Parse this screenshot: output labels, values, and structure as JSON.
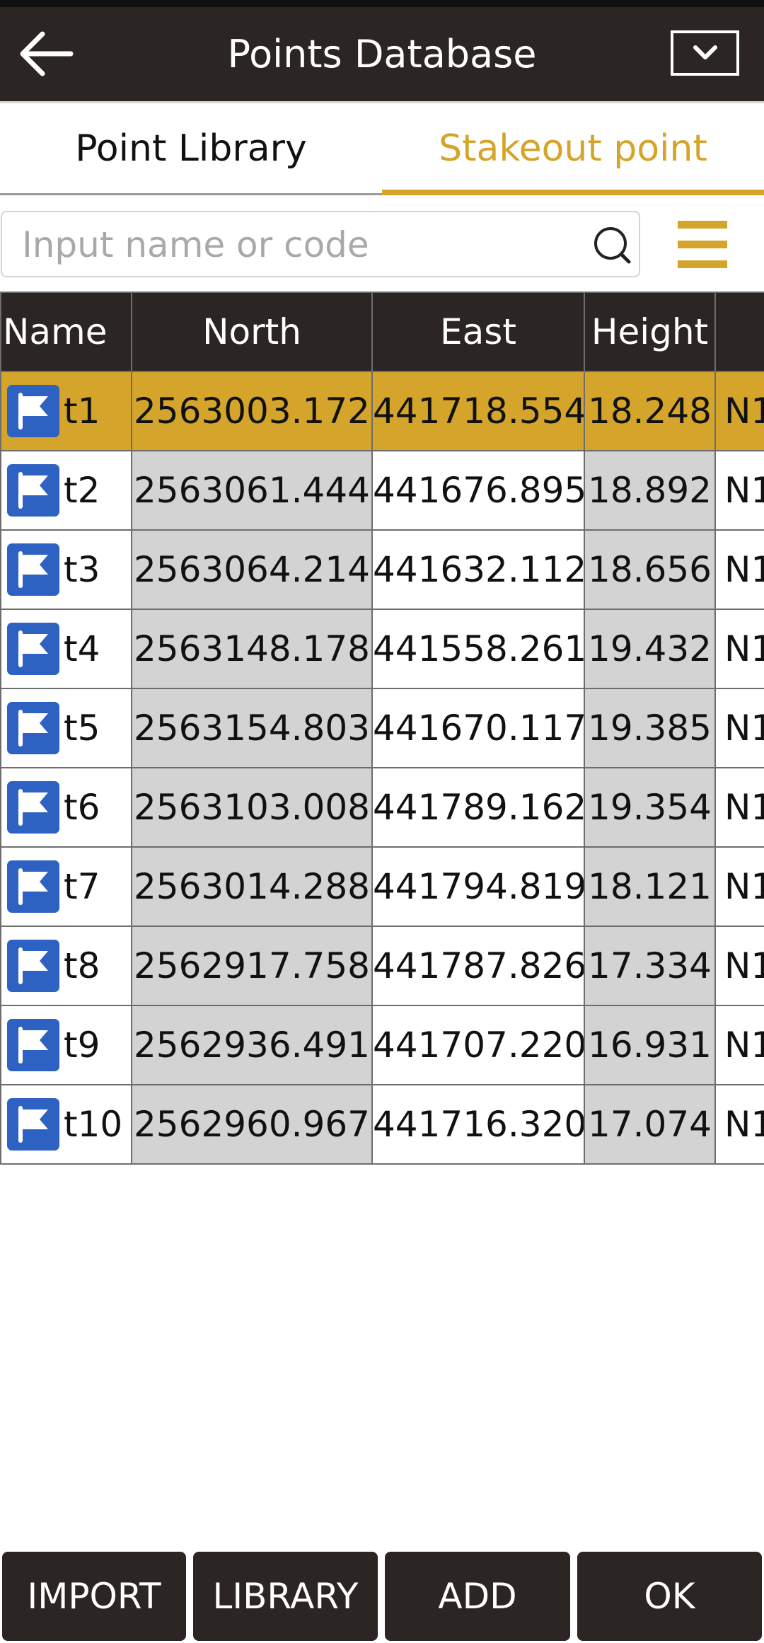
{
  "header": {
    "title": "Points Database"
  },
  "tabs": {
    "library": "Point Library",
    "stakeout": "Stakeout point"
  },
  "search": {
    "placeholder": "Input name or code",
    "value": ""
  },
  "table": {
    "columns": {
      "name": "Name",
      "north": "North",
      "east": "East",
      "height": "Height",
      "code": ""
    },
    "rows": [
      {
        "name": "t1",
        "north": "2563003.172",
        "east": "441718.554",
        "height": "18.248",
        "code": "N1"
      },
      {
        "name": "t2",
        "north": "2563061.444",
        "east": "441676.895",
        "height": "18.892",
        "code": "N1"
      },
      {
        "name": "t3",
        "north": "2563064.214",
        "east": "441632.112",
        "height": "18.656",
        "code": "N1"
      },
      {
        "name": "t4",
        "north": "2563148.178",
        "east": "441558.261",
        "height": "19.432",
        "code": "N1"
      },
      {
        "name": "t5",
        "north": "2563154.803",
        "east": "441670.117",
        "height": "19.385",
        "code": "N1"
      },
      {
        "name": "t6",
        "north": "2563103.008",
        "east": "441789.162",
        "height": "19.354",
        "code": "N1"
      },
      {
        "name": "t7",
        "north": "2563014.288",
        "east": "441794.819",
        "height": "18.121",
        "code": "N1"
      },
      {
        "name": "t8",
        "north": "2562917.758",
        "east": "441787.826",
        "height": "17.334",
        "code": "N1"
      },
      {
        "name": "t9",
        "north": "2562936.491",
        "east": "441707.220",
        "height": "16.931",
        "code": "N1"
      },
      {
        "name": "t10",
        "north": "2562960.967",
        "east": "441716.320",
        "height": "17.074",
        "code": "N1"
      }
    ]
  },
  "buttons": {
    "import": "IMPORT",
    "library": "LIBRARY",
    "add": "ADD",
    "ok": "OK"
  },
  "colors": {
    "accent": "#d4a52a",
    "header_bg": "#2b2524",
    "flag_blue": "#2e62c2",
    "grey_cell": "#d3d3d3"
  }
}
